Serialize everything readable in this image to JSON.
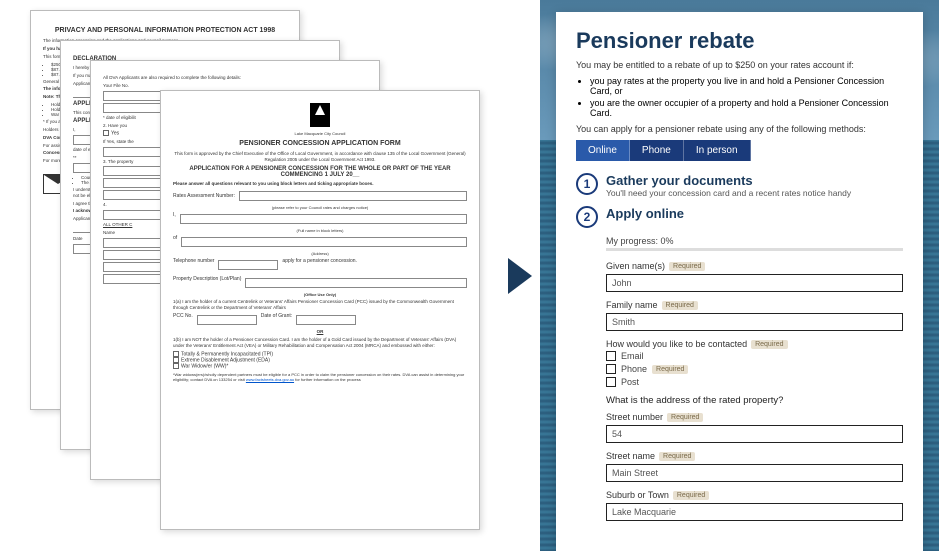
{
  "paper1": {
    "title": "PRIVACY AND PERSONAL INFORMATION PROTECTION ACT 1998",
    "body": "The information assessing and the applications and council purpose.",
    "bold1": "If you have Public Or corrected",
    "body2": "This form ratepayer",
    "bullets": [
      "$250",
      "$87.5",
      "$87.5"
    ],
    "body3": "General granted to",
    "bold2": "The information to receive",
    "bold3": "Note: The conces receiving a Cer Concess",
    "hold_bullets": [
      "Hold",
      "Hold",
      "War"
    ],
    "body4": "* If you are contact the supplement",
    "body5": "Holders of",
    "bold4": "DVA Cor",
    "body6": "For assist",
    "bold5": "Concess",
    "body7": "For more"
  },
  "paper2": {
    "h1": "DECLARATION",
    "line1": "I hereby declare that the information provided is true and correct.",
    "line2": "If you make a false statement in an application you may be guilty of an offence and fined up to $2,200",
    "sig_label": "Applicant Sign",
    "h2": "APPLICATI",
    "consent": "This consent w Lake Macquarie provided by Co",
    "h3": "APPLICATI",
    "date_label": "date of eligi",
    "council": "Council to use Veterans' Affair if I qualify for a",
    "aust": "The Australian enquiry to the Centrelink or Ce receiving a Cer",
    "understand": "I understand th for the conces payment and cr I understand th I withdraw it by I can obtain pri my eligibility fi I understand if may not be elig I also understa (Further inform website at",
    "agree": "I agree that, un be relied on by",
    "ack": "I acknowledge t",
    "sig2": "Applicant Signat",
    "date2": "Date"
  },
  "paper3": {
    "dva": "All DVA Applicants are also required to complete the following details:",
    "file": "Your File No.",
    "date_label": "* date of eligibilit",
    "q2": "2. Have you",
    "yes": "Yes",
    "ifyes": "If Yes, state the",
    "q3": "3. The property",
    "q4": "4.",
    "other": "ALL OTHER C",
    "name": "Name"
  },
  "paper4": {
    "council": "Lake Macquarie City Council",
    "title": "PENSIONER CONCESSION APPLICATION FORM",
    "sub1": "This form is approved by the Chief Executive of the Office of Local Government, in accordance with clause 135 of the Local Government (General) Regulation 2005 under the Local Government Act 1993.",
    "sub2": "APPLICATION FOR A PENSIONER CONCESSION FOR THE WHOLE OR PART OF THE YEAR COMMENCING 1 JULY 20__",
    "sub3": "Please answer all questions relevant to you using block letters and ticking appropriate boxes.",
    "rates_label": "Rates Assessment Number:",
    "rates_hint": "(please refer to your Council rates and charges notice)",
    "i_label": "I,",
    "name_hint": "(Full name in block letters)",
    "of_label": "of",
    "addr_hint": "(Address)",
    "tel_label": "Telephone number",
    "apply": "apply for a pensioner concession.",
    "prop_label": "Property Description (Lot/Plan)",
    "office": "(Office Use Only)",
    "q1a": "1(a)  I am the holder of a current Centrelink or Veterans' Affairs Pensioner Concession Card (PCC) issued by the Commonwealth Government through Centrelink or the Department of Veterans' Affairs",
    "pcc": "PCC No.",
    "grant": "Date of Grant:",
    "or": "OR",
    "q1b": "1(b)  I am NOT the holder of a Pensioner Concession Card. I am the holder of a Gold Card issued by the Department of Veterans' Affairs (DVA) under the Veterans' Entitlement Act (VEA) or Military Rehabilitation and Compensation Act 2004 (MRCA) and embossed with either:",
    "tpi": "Totally & Permanently Incapacitated (TPI)",
    "eda": "Extreme Disablement Adjustment (EDA)",
    "ww": "War Widow/er (WW)*",
    "foot": "*War widows(ers)/wholly dependent partners must be eligible for a PCC in order to claim the pensioner concession on their rates. DVA can assist in determining your eligibility; contact DVA on 133254 or visit",
    "link": "www.factsheets.dva.gov.au",
    "foot2": " for further information on the process"
  },
  "right": {
    "heading": "Pensioner rebate",
    "intro": "You may be entitled to a rebate of up to $250 on your rates account if:",
    "bullets": [
      "you pay rates at the property you live in and hold a Pensioner Concession Card, or",
      "you are the owner occupier of a property and hold a Pensioner Concession Card."
    ],
    "intro2": "You can apply for a pensioner rebate using any of the following methods:",
    "tabs": {
      "online": "Online",
      "phone": "Phone",
      "person": "In person"
    },
    "step1": {
      "title": "Gather your documents",
      "desc": "You'll need your concession card and a recent rates notice handy"
    },
    "step2": {
      "title": "Apply online"
    },
    "progress_label": "My progress: 0%",
    "required": "Required",
    "given": {
      "label": "Given name(s)",
      "value": "John"
    },
    "family": {
      "label": "Family name",
      "value": "Smith"
    },
    "contact_q": "How would you like to be contacted",
    "contact": {
      "email": "Email",
      "phone": "Phone",
      "post": "Post"
    },
    "addr_q": "What is the address of the rated property?",
    "street_num": {
      "label": "Street number",
      "value": "54"
    },
    "street_name": {
      "label": "Street name",
      "value": "Main Street"
    },
    "suburb": {
      "label": "Suburb or Town",
      "value": "Lake Macquarie"
    }
  }
}
